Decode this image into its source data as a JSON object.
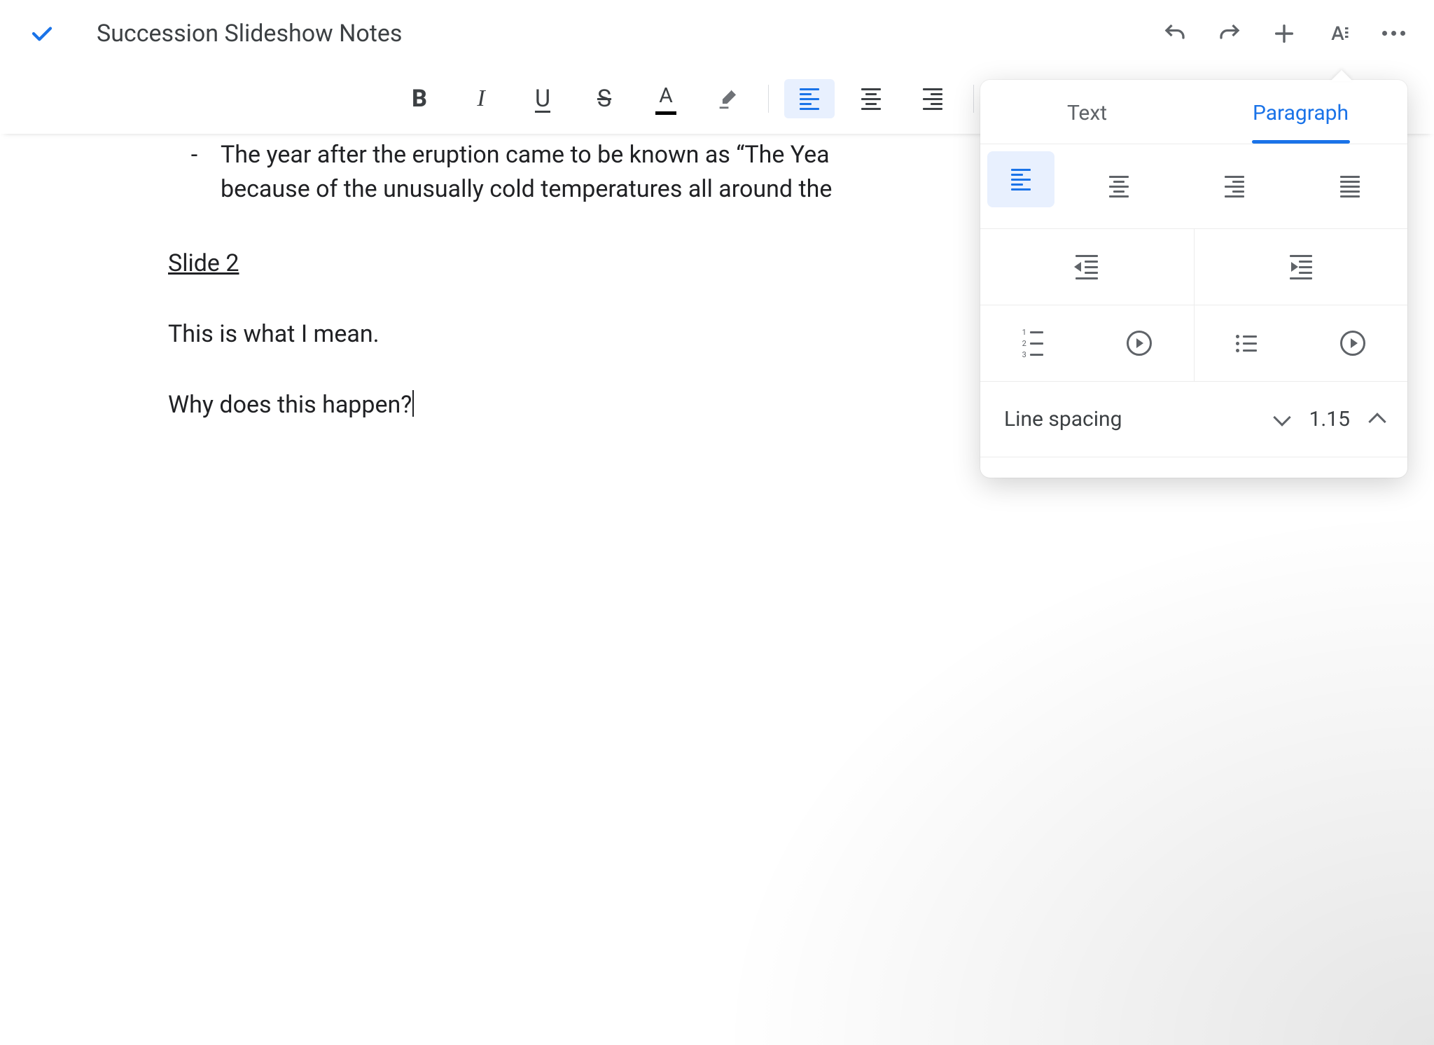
{
  "header": {
    "title": "Succession Slideshow Notes"
  },
  "doc": {
    "bullet_line1": "The year after the eruption came to be known as “The Yea",
    "bullet_line2": "because of the unusually cold temperatures all around the",
    "slide_heading": "Slide 2",
    "para1": "This is what I mean.",
    "para2": "Why does this happen?"
  },
  "panel": {
    "tabs": {
      "text": "Text",
      "paragraph": "Paragraph"
    },
    "active_tab": "paragraph",
    "alignment_selected": "left",
    "line_spacing_label": "Line spacing",
    "line_spacing_value": "1.15"
  },
  "colors": {
    "accent": "#1a73e8"
  }
}
